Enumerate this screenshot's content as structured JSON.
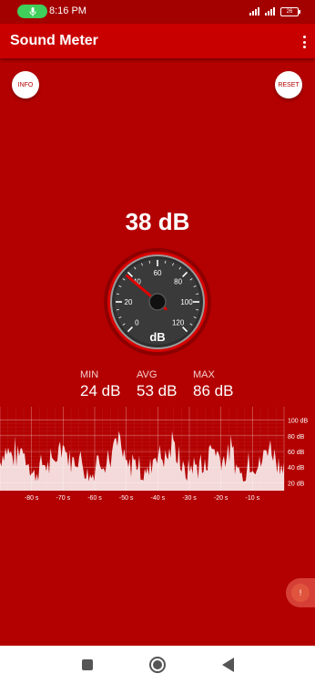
{
  "status_bar": {
    "time": "8:16 PM",
    "battery": "26"
  },
  "app_bar": {
    "title": "Sound Meter"
  },
  "buttons": {
    "info": "INFO",
    "reset": "RESET"
  },
  "meter": {
    "value": "38 dB",
    "reading": 38,
    "unit": "dB",
    "scale": [
      "0",
      "20",
      "40",
      "60",
      "80",
      "100",
      "120"
    ],
    "min": 0,
    "max": 120
  },
  "stats": {
    "min_label": "MIN",
    "min_value": "24 dB",
    "avg_label": "AVG",
    "avg_value": "53 dB",
    "max_label": "MAX",
    "max_value": "86 dB"
  },
  "graph": {
    "y_labels": [
      "100 dB",
      "80 dB",
      "60 dB",
      "40 dB",
      "20 dB"
    ],
    "x_labels": [
      "-80 s",
      "-70 s",
      "-60 s",
      "-50 s",
      "-40 s",
      "-30 s",
      "-20 s",
      "-10 s"
    ],
    "fill_color": "#ffffff",
    "line_color": "#ffffff"
  },
  "colors": {
    "background": "#b30000",
    "app_bar": "#c80000",
    "needle": "#e00000"
  }
}
